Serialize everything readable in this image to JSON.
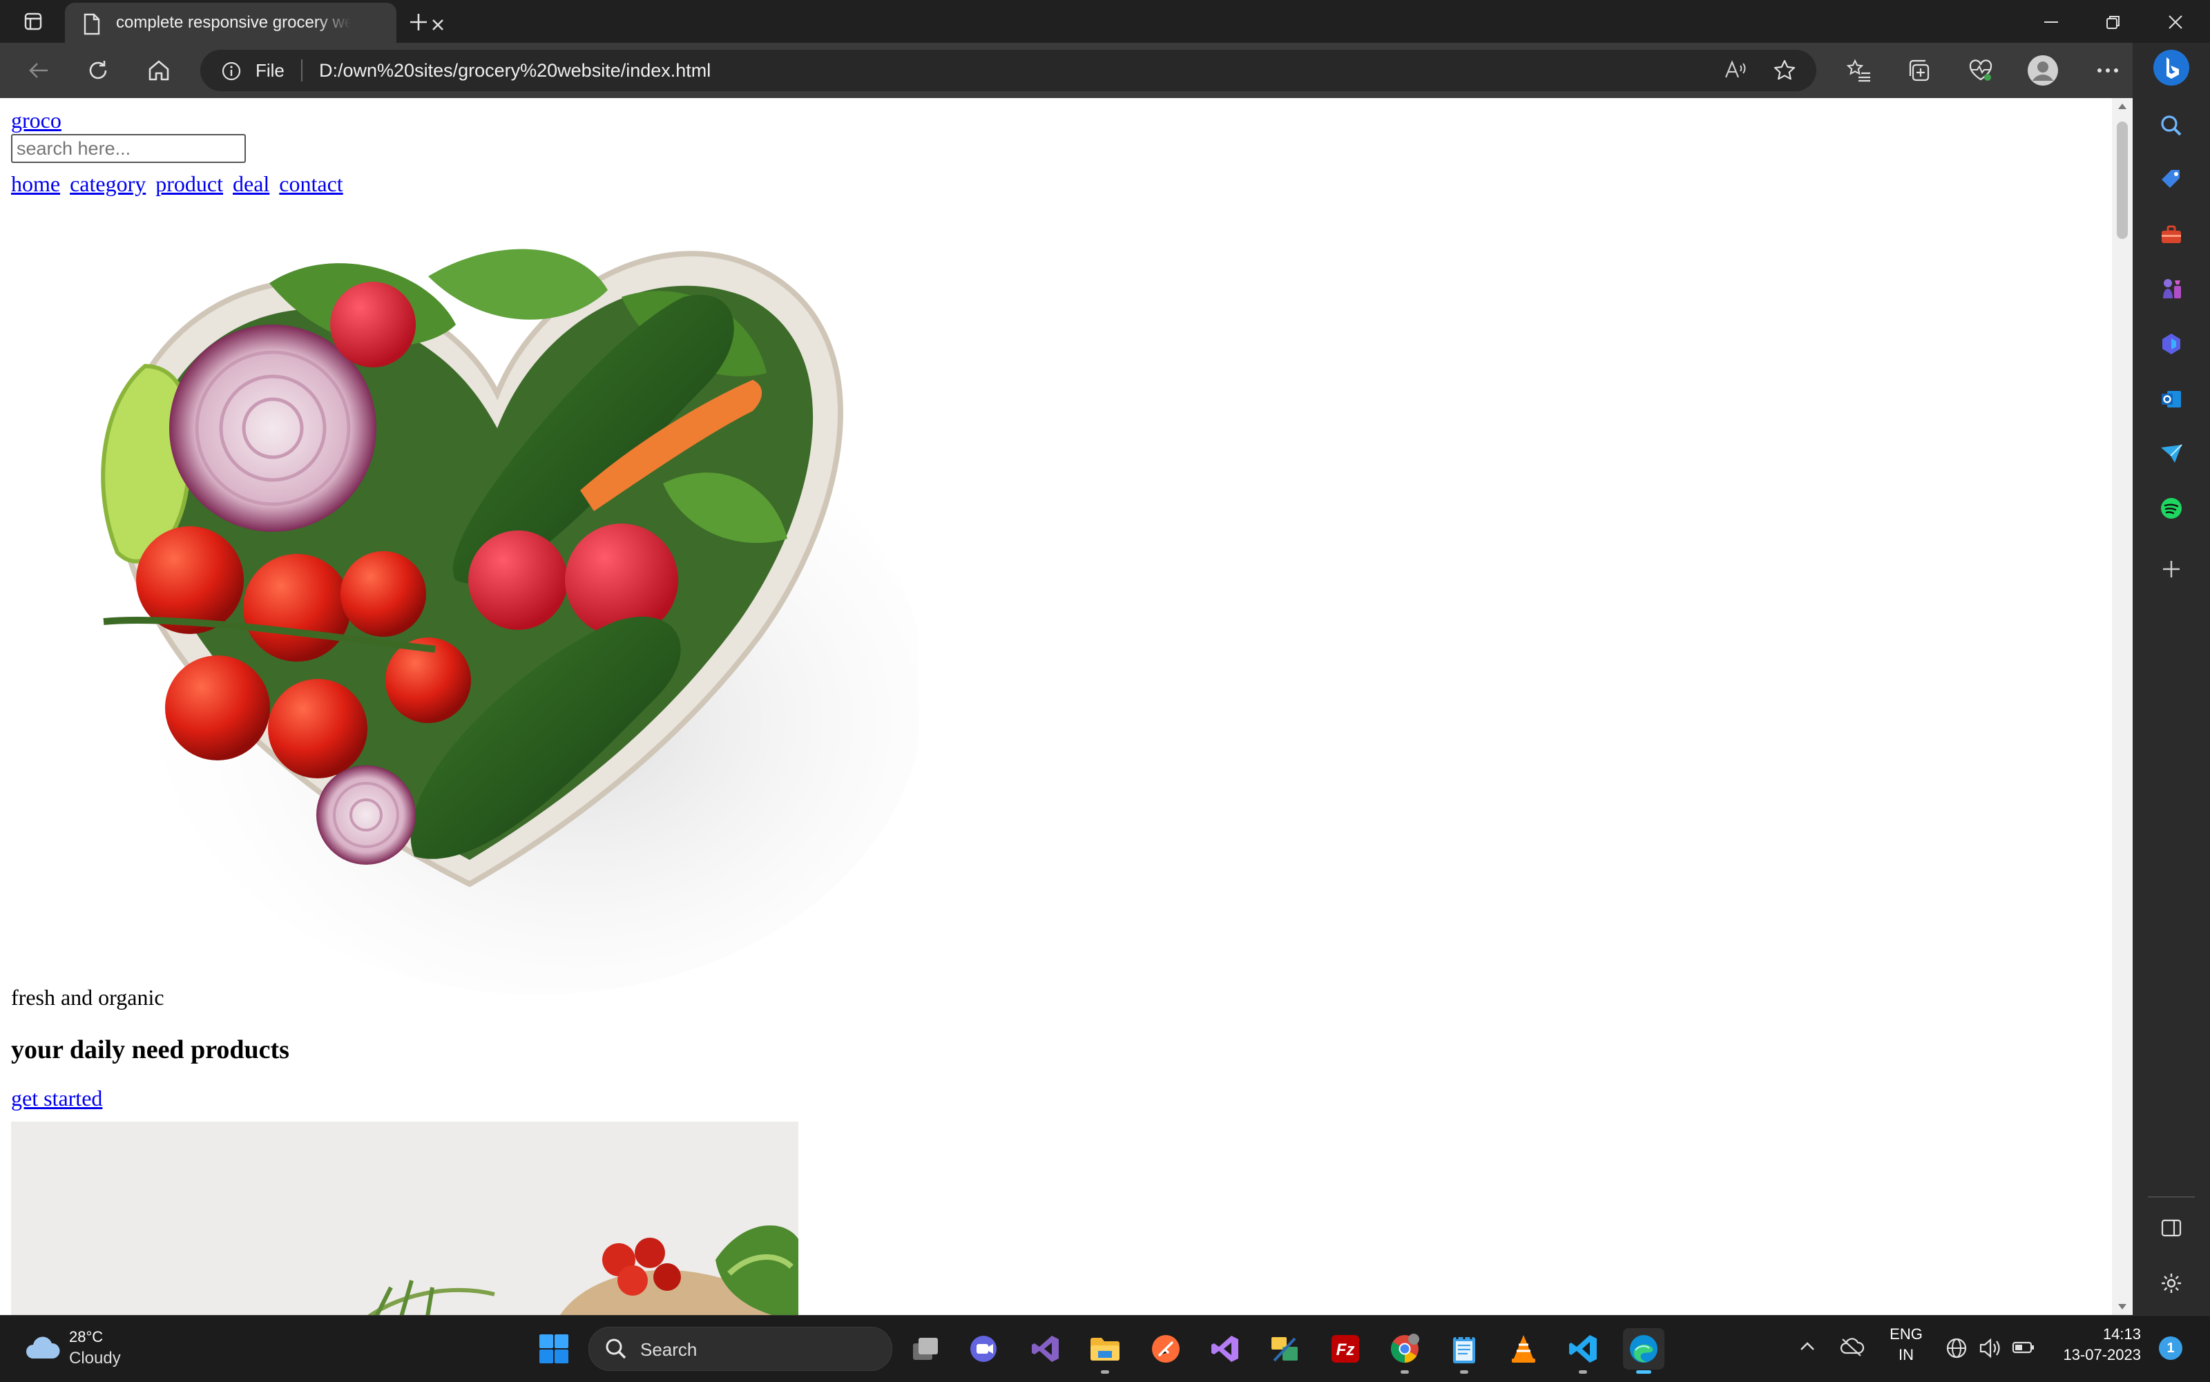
{
  "browser": {
    "tab": {
      "title": "complete responsive grocery website"
    },
    "address_bar": {
      "scheme_label": "File",
      "url": "D:/own%20sites/grocery%20website/index.html",
      "read_aloud_label": "A̅"
    }
  },
  "page": {
    "logo": "groco",
    "search": {
      "placeholder": "search here...",
      "value": ""
    },
    "nav": [
      "home",
      "category",
      "product",
      "deal",
      "contact"
    ],
    "hero": {
      "subtitle": "fresh and organic",
      "title": "your daily need products",
      "cta": "get started"
    }
  },
  "taskbar": {
    "weather": {
      "temp": "28°C",
      "condition": "Cloudy"
    },
    "search_label": "Search",
    "language": {
      "line1": "ENG",
      "line2": "IN"
    },
    "clock": {
      "time": "14:13",
      "date": "13-07-2023"
    },
    "notification_count": "1"
  },
  "colors": {
    "link": "#0000ee",
    "chrome_dark": "#202020",
    "toolbar": "#3b3b3b",
    "accent": "#4cc2ff"
  }
}
